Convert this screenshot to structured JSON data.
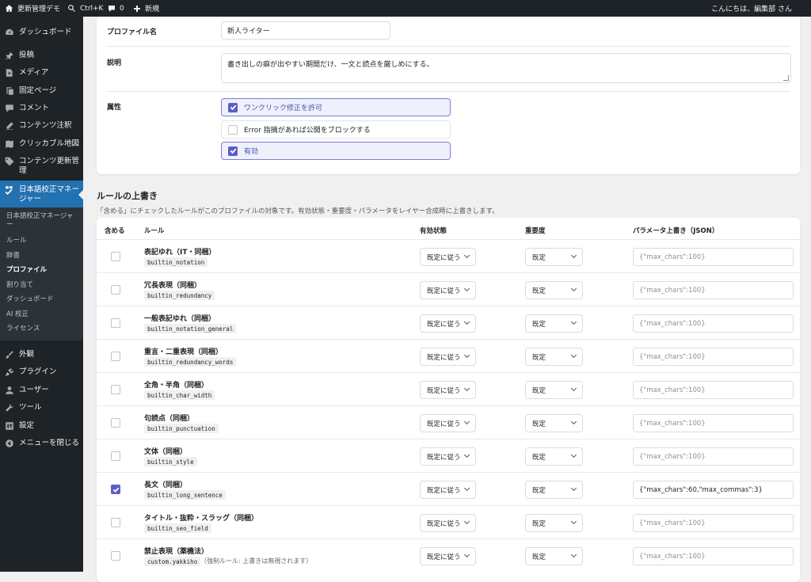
{
  "adminbar": {
    "site_name": "更新管理デモ",
    "search_shortcut": "Ctrl+K",
    "comments_count": "0",
    "new_label": "新規",
    "greeting": "こんにちは、編集部 さん"
  },
  "sidebar": {
    "items": [
      {
        "label": "ダッシュボード",
        "icon": "dashboard-icon"
      },
      {
        "label": "投稿",
        "icon": "pin-icon"
      },
      {
        "label": "メディア",
        "icon": "media-icon"
      },
      {
        "label": "固定ページ",
        "icon": "page-icon"
      },
      {
        "label": "コメント",
        "icon": "comment-icon"
      },
      {
        "label": "コンテンツ注釈",
        "icon": "pencil-icon"
      },
      {
        "label": "クリッカブル地図",
        "icon": "map-icon"
      },
      {
        "label": "コンテンツ更新管理",
        "icon": "tag-icon"
      },
      {
        "label": "日本語校正マネージャー",
        "icon": "spellcheck-icon"
      }
    ],
    "submenu": [
      {
        "label": "日本語校正マネージャー"
      },
      {
        "label": "ルール"
      },
      {
        "label": "辞書"
      },
      {
        "label": "プロファイル"
      },
      {
        "label": "割り当て"
      },
      {
        "label": "ダッシュボード"
      },
      {
        "label": "AI 校正"
      },
      {
        "label": "ライセンス"
      }
    ],
    "bottom_items": [
      {
        "label": "外観",
        "icon": "brush-icon"
      },
      {
        "label": "プラグイン",
        "icon": "plugin-icon"
      },
      {
        "label": "ユーザー",
        "icon": "user-icon"
      },
      {
        "label": "ツール",
        "icon": "wrench-icon"
      },
      {
        "label": "設定",
        "icon": "settings-icon"
      },
      {
        "label": "メニューを閉じる",
        "icon": "collapse-icon"
      }
    ]
  },
  "profile_form": {
    "name_label": "プロファイル名",
    "name_value": "新人ライター",
    "desc_label": "説明",
    "desc_value": "書き出しの癖が出やすい期間だけ、一文と読点を厳しめにする。",
    "attr_label": "属性",
    "options": [
      {
        "label": "ワンクリック修正を許可",
        "checked": true
      },
      {
        "label": "Error 指摘があれば公開をブロックする",
        "checked": false
      },
      {
        "label": "有効",
        "checked": true
      }
    ]
  },
  "rules_section": {
    "title": "ルールの上書き",
    "description": "「含める」にチェックしたルールがこのプロファイルの対象です。有効状態・重要度・パラメータをレイヤー合成時に上書きします。",
    "headers": {
      "include": "含める",
      "rule": "ルール",
      "status": "有効状態",
      "severity": "重要度",
      "params": "パラメータ上書き（JSON）"
    },
    "rows": [
      {
        "name": "表記ゆれ（IT・同梱）",
        "slug": "builtin_notation",
        "included": false,
        "status": "既定に従う",
        "severity": "既定",
        "params": "{\"max_chars\":100}",
        "params_filled": false,
        "note": ""
      },
      {
        "name": "冗長表現（同梱）",
        "slug": "builtin_redundancy",
        "included": false,
        "status": "既定に従う",
        "severity": "既定",
        "params": "{\"max_chars\":100}",
        "params_filled": false,
        "note": ""
      },
      {
        "name": "一般表記ゆれ（同梱）",
        "slug": "builtin_notation_general",
        "included": false,
        "status": "既定に従う",
        "severity": "既定",
        "params": "{\"max_chars\":100}",
        "params_filled": false,
        "note": ""
      },
      {
        "name": "重言・二重表現（同梱）",
        "slug": "builtin_redundancy_words",
        "included": false,
        "status": "既定に従う",
        "severity": "既定",
        "params": "{\"max_chars\":100}",
        "params_filled": false,
        "note": ""
      },
      {
        "name": "全角・半角（同梱）",
        "slug": "builtin_char_width",
        "included": false,
        "status": "既定に従う",
        "severity": "既定",
        "params": "{\"max_chars\":100}",
        "params_filled": false,
        "note": ""
      },
      {
        "name": "句読点（同梱）",
        "slug": "builtin_punctuation",
        "included": false,
        "status": "既定に従う",
        "severity": "既定",
        "params": "{\"max_chars\":100}",
        "params_filled": false,
        "note": ""
      },
      {
        "name": "文体（同梱）",
        "slug": "builtin_style",
        "included": false,
        "status": "既定に従う",
        "severity": "既定",
        "params": "{\"max_chars\":100}",
        "params_filled": false,
        "note": ""
      },
      {
        "name": "長文（同梱）",
        "slug": "builtin_long_sentence",
        "included": true,
        "status": "既定に従う",
        "severity": "既定",
        "params": "{\"max_chars\":60,\"max_commas\":3}",
        "params_filled": true,
        "note": ""
      },
      {
        "name": "タイトル・抜粋・スラッグ（同梱）",
        "slug": "builtin_seo_field",
        "included": false,
        "status": "既定に従う",
        "severity": "既定",
        "params": "{\"max_chars\":100}",
        "params_filled": false,
        "note": ""
      },
      {
        "name": "禁止表現（薬機法）",
        "slug": "custom.yakkiho",
        "included": false,
        "status": "既定に従う",
        "severity": "既定",
        "params": "{\"max_chars\":100}",
        "params_filled": false,
        "note": "（強制ルール: 上書きは無視されます）"
      }
    ]
  },
  "colors": {
    "admin_dark": "#1d2327",
    "active_menu": "#2271b1",
    "checkbox_accent": "#5b5fc7"
  }
}
